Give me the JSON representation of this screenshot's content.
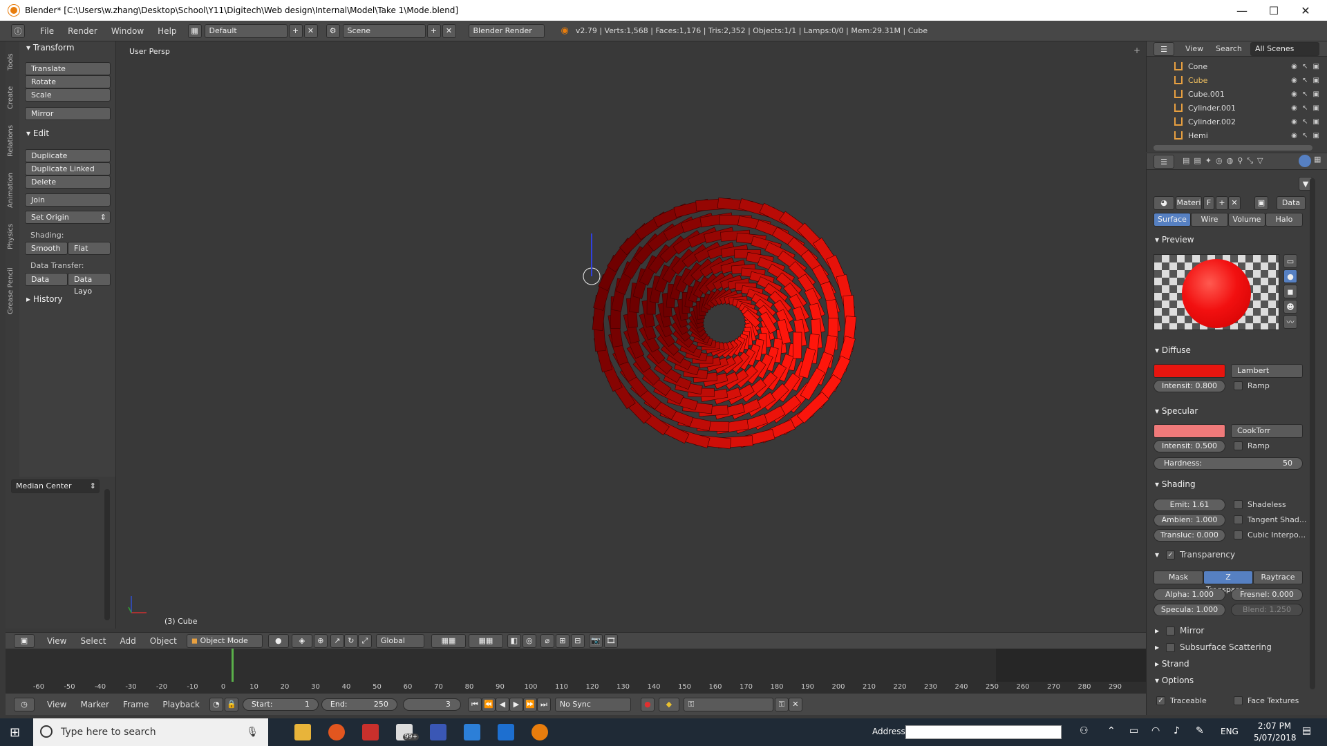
{
  "window": {
    "title": "Blender* [C:\\Users\\w.zhang\\Desktop\\School\\Y11\\Digitech\\Web design\\Internal\\Model\\Take 1\\Mode.blend]",
    "min": "—",
    "max": "☐",
    "close": "✕"
  },
  "info": {
    "menus": [
      "File",
      "Render",
      "Window",
      "Help"
    ],
    "layout": "Default",
    "scene": "Scene",
    "engine": "Blender Render",
    "stats": "v2.79 | Verts:1,568 | Faces:1,176 | Tris:2,352 | Objects:1/1 | Lamps:0/0 | Mem:29.31M | Cube"
  },
  "shelf": {
    "tabs": [
      "Tools",
      "Create",
      "Relations",
      "Animation",
      "Physics",
      "Grease Pencil"
    ],
    "transform_hdr": "Transform",
    "translate": "Translate",
    "rotate": "Rotate",
    "scale": "Scale",
    "mirror": "Mirror",
    "edit_hdr": "Edit",
    "duplicate": "Duplicate",
    "duplicate_linked": "Duplicate Linked",
    "delete": "Delete",
    "join": "Join",
    "set_origin": "Set Origin",
    "shading_lbl": "Shading:",
    "smooth": "Smooth",
    "flat": "Flat",
    "data_transfer_lbl": "Data Transfer:",
    "data": "Data",
    "data_layout": "Data Layo",
    "history_hdr": "History",
    "pivot": "Median Center"
  },
  "viewport": {
    "view_name": "User Persp",
    "object_label": "(3) Cube",
    "header": {
      "view": "View",
      "select": "Select",
      "add": "Add",
      "object": "Object",
      "mode": "Object Mode",
      "orientation": "Global"
    }
  },
  "timeline": {
    "ticks": [
      "-60",
      "-50",
      "-40",
      "-30",
      "-20",
      "-10",
      "0",
      "10",
      "20",
      "30",
      "40",
      "50",
      "60",
      "70",
      "80",
      "90",
      "100",
      "110",
      "120",
      "130",
      "140",
      "150",
      "160",
      "170",
      "180",
      "190",
      "200",
      "210",
      "220",
      "230",
      "240",
      "250",
      "260",
      "270",
      "280",
      "290"
    ],
    "current_frame_value": 3,
    "header": {
      "view": "View",
      "marker": "Marker",
      "frame": "Frame",
      "playback": "Playback",
      "start_lbl": "Start:",
      "start": "1",
      "end_lbl": "End:",
      "end": "250",
      "current": "3",
      "sync": "No Sync"
    }
  },
  "outliner": {
    "view": "View",
    "search": "Search",
    "scenes": "All Scenes",
    "items": [
      "Cone",
      "Cube",
      "Cube.001",
      "Cylinder.001",
      "Cylinder.002",
      "Hemi"
    ]
  },
  "properties": {
    "material_name": "Materi",
    "f_label": "F",
    "data_label": "Data",
    "tabs": [
      "Surface",
      "Wire",
      "Volume",
      "Halo"
    ],
    "preview_hdr": "Preview",
    "diffuse_hdr": "Diffuse",
    "diffuse_shader": "Lambert",
    "diffuse_intensity": "Intensit: 0.800",
    "ramp": "Ramp",
    "specular_hdr": "Specular",
    "specular_shader": "CookTorr",
    "specular_intensity": "Intensit: 0.500",
    "hardness_lbl": "Hardness:",
    "hardness": "50",
    "shading_hdr": "Shading",
    "emit": "Emit:   1.61",
    "ambient": "Ambien: 1.000",
    "translucency": "Transluc: 0.000",
    "shadeless": "Shadeless",
    "tangent": "Tangent Shad...",
    "cubic": "Cubic Interpo...",
    "transparency_hdr": "Transparency",
    "mask": "Mask",
    "ztransp": "Z Transpare...",
    "raytrace": "Raytrace",
    "alpha": "Alpha:   1.000",
    "fresnel": "Fresnel: 0.000",
    "specular_alpha": "Specula: 1.000",
    "blend": "Blend:   1.250",
    "mirror_hdr": "Mirror",
    "sss_hdr": "Subsurface Scattering",
    "strand_hdr": "Strand",
    "options_hdr": "Options",
    "traceable": "Traceable",
    "face_textures": "Face Textures",
    "colors": {
      "diffuse": "#e8150f",
      "specular": "#f07a7a",
      "accent": "#5680c2"
    }
  },
  "taskbar": {
    "search_placeholder": "Type here to search",
    "address_lbl": "Address",
    "lang": "ENG",
    "time": "2:07 PM",
    "date": "5/07/2018",
    "badge": "99+"
  }
}
